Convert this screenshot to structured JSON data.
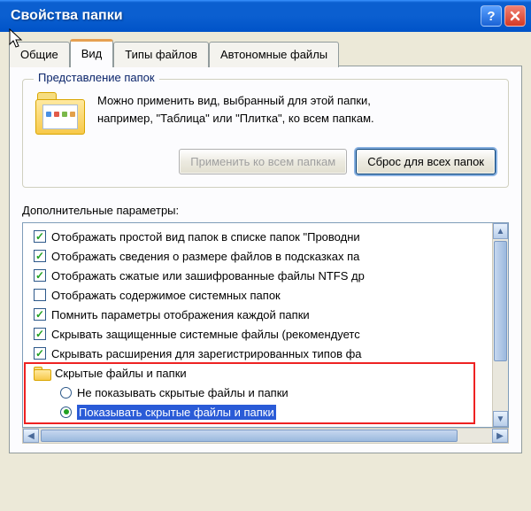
{
  "window": {
    "title": "Свойства папки"
  },
  "tabs": {
    "general": "Общие",
    "view": "Вид",
    "filetypes": "Типы файлов",
    "offline": "Автономные файлы"
  },
  "group": {
    "title": "Представление папок",
    "text_l1": "Можно применить вид, выбранный для этой папки,",
    "text_l2": "например, \"Таблица\" или \"Плитка\", ко всем папкам.",
    "apply_btn": "Применить ко всем папкам",
    "reset_btn": "Сброс для всех папок"
  },
  "advanced": {
    "label": "Дополнительные параметры:",
    "items": {
      "i0": "Отображать простой вид папок в списке папок \"Проводни",
      "i1": "Отображать сведения о размере файлов в подсказках па",
      "i2": "Отображать сжатые или зашифрованные файлы NTFS др",
      "i3": "Отображать содержимое системных папок",
      "i4": "Помнить параметры отображения каждой папки",
      "i5": "Скрывать защищенные системные файлы (рекомендуетс",
      "i6": "Скрывать расширения для зарегистрированных типов фа",
      "i7": "Скрытые файлы и папки",
      "i7a": "Не показывать скрытые файлы и папки",
      "i7b": "Показывать скрытые файлы и папки"
    }
  }
}
